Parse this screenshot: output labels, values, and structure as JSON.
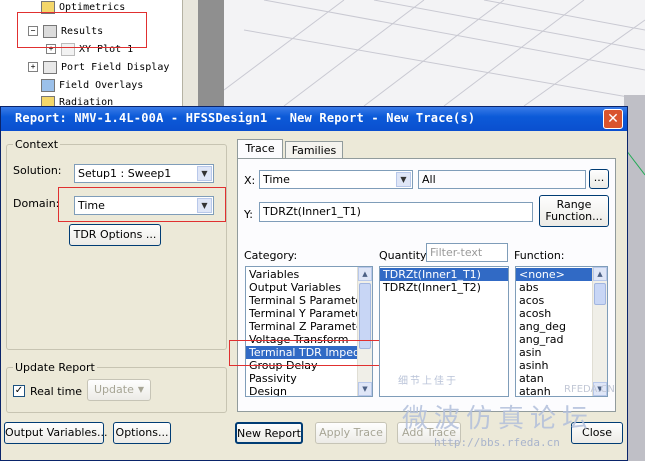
{
  "tree": {
    "items": [
      {
        "label": "Optimetrics",
        "expander": ""
      },
      {
        "label": "Results",
        "expander": "−"
      },
      {
        "label": "XY Plot 1",
        "expander": "+"
      },
      {
        "label": "Port Field Display",
        "expander": "+"
      },
      {
        "label": "Field Overlays",
        "expander": ""
      },
      {
        "label": "Radiation",
        "expander": ""
      }
    ]
  },
  "dialog": {
    "title": "Report: NMV-1.4L-00A - HFSSDesign1 - New Report - New Trace(s)",
    "close_label": "✕",
    "context": {
      "legend": "Context",
      "solution_label": "Solution:",
      "solution_value": "Setup1 : Sweep1",
      "domain_label": "Domain:",
      "domain_value": "Time",
      "tdr_options_label": "TDR Options ..."
    },
    "update_report": {
      "legend": "Update Report",
      "realtime_label": "Real time",
      "realtime_checked": true,
      "update_label": "Update"
    },
    "tabs": [
      {
        "label": "Trace",
        "active": true
      },
      {
        "label": "Families",
        "active": false
      }
    ],
    "x": {
      "label": "X:",
      "value": "Time",
      "range_value": "All",
      "ellipsis": "..."
    },
    "y": {
      "label": "Y:",
      "value": "TDRZt(Inner1_T1)",
      "range_function_label": "Range\nFunction..."
    },
    "category": {
      "label": "Category:",
      "items": [
        "Variables",
        "Output Variables",
        "Terminal S Parameter",
        "Terminal Y Parameter",
        "Terminal Z Parameter",
        "Voltage Transform",
        "Terminal TDR Impedan",
        "Group Delay",
        "Passivity",
        "Design"
      ],
      "selected_index": 6
    },
    "quantity": {
      "label": "Quantity:",
      "filter_placeholder": "Filter-text",
      "items": [
        "TDRZt(Inner1_T1)",
        "TDRZt(Inner1_T2)"
      ],
      "selected_index": 0
    },
    "function": {
      "label": "Function:",
      "items": [
        "<none>",
        "abs",
        "acos",
        "acosh",
        "ang_deg",
        "ang_rad",
        "asin",
        "asinh",
        "atan",
        "atanh"
      ],
      "selected_index": 0
    },
    "buttons": {
      "output_variables": "Output Variables...",
      "options": "Options...",
      "new_report": "New Report",
      "apply_trace": "Apply Trace",
      "add_trace": "Add Trace",
      "close": "Close"
    }
  },
  "watermark": {
    "text_cn": "微波仿真论坛",
    "url": "http://bbs.rfeda.cn",
    "small_cn": "细节上佳于",
    "brand": "RFEDA.CN"
  },
  "colors": {
    "title_bar": "#0c5ad8",
    "selection": "#316ac5",
    "highlight_box": "#e03030",
    "dialog_bg": "#ece9d8"
  }
}
